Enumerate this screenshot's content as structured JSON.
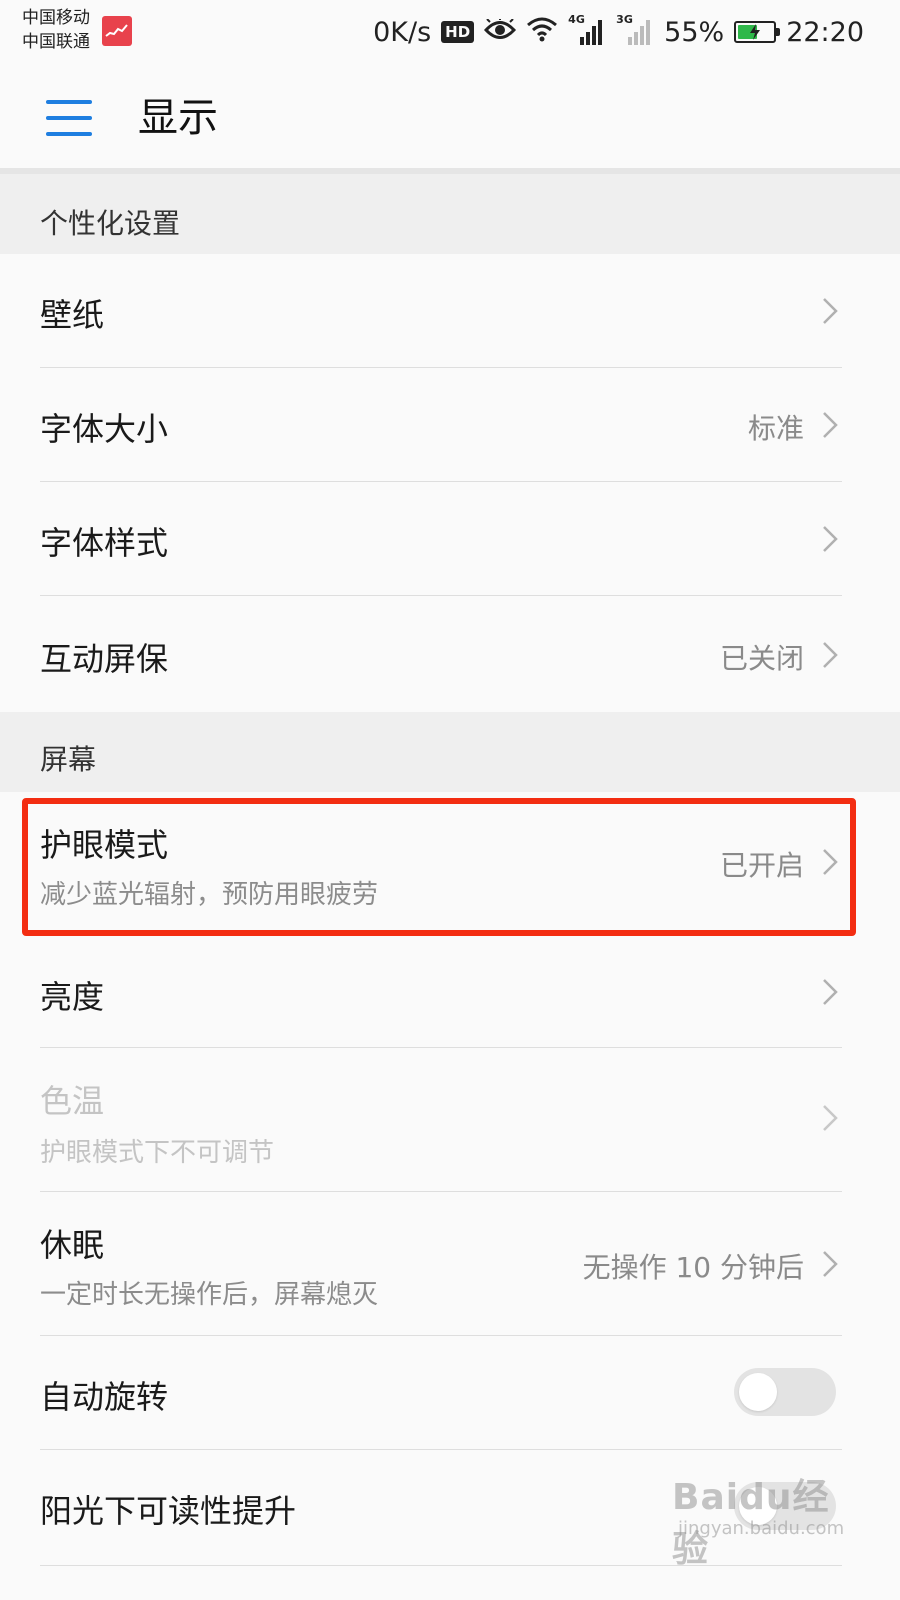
{
  "status_bar": {
    "carrier_1": "中国移动",
    "carrier_2": "中国联通",
    "network_speed": "0K/s",
    "hd_badge": "HD",
    "network_4g": "4G",
    "network_3g": "3G",
    "battery_percent": "55%",
    "battery_level": 0.55,
    "time": "22:20",
    "icons": [
      "eye-comfort-icon",
      "wifi-icon",
      "signal-icon",
      "battery-icon"
    ]
  },
  "app_bar": {
    "title": "显示"
  },
  "sections": [
    {
      "header": "个性化设置",
      "items": [
        {
          "title": "壁纸",
          "value": ""
        },
        {
          "title": "字体大小",
          "value": "标准"
        },
        {
          "title": "字体样式",
          "value": ""
        },
        {
          "title": "互动屏保",
          "value": "已关闭"
        }
      ]
    },
    {
      "header": "屏幕",
      "items": [
        {
          "title": "护眼模式",
          "subtitle": "减少蓝光辐射，预防用眼疲劳",
          "value": "已开启",
          "highlighted": true
        },
        {
          "title": "亮度",
          "value": ""
        },
        {
          "title": "色温",
          "subtitle": "护眼模式下不可调节",
          "value": "",
          "disabled": true
        },
        {
          "title": "休眠",
          "subtitle": "一定时长无操作后，屏幕熄灭",
          "value": "无操作 10 分钟后"
        },
        {
          "title": "自动旋转",
          "toggle": false
        },
        {
          "title": "阳光下可读性提升",
          "toggle": false
        }
      ]
    }
  ],
  "watermark": {
    "brand": "Baidu经验",
    "url": "jingyan.baidu.com"
  },
  "colors": {
    "accent": "#1e7ee0",
    "highlight": "#f32d12",
    "battery": "#2fb84a"
  }
}
